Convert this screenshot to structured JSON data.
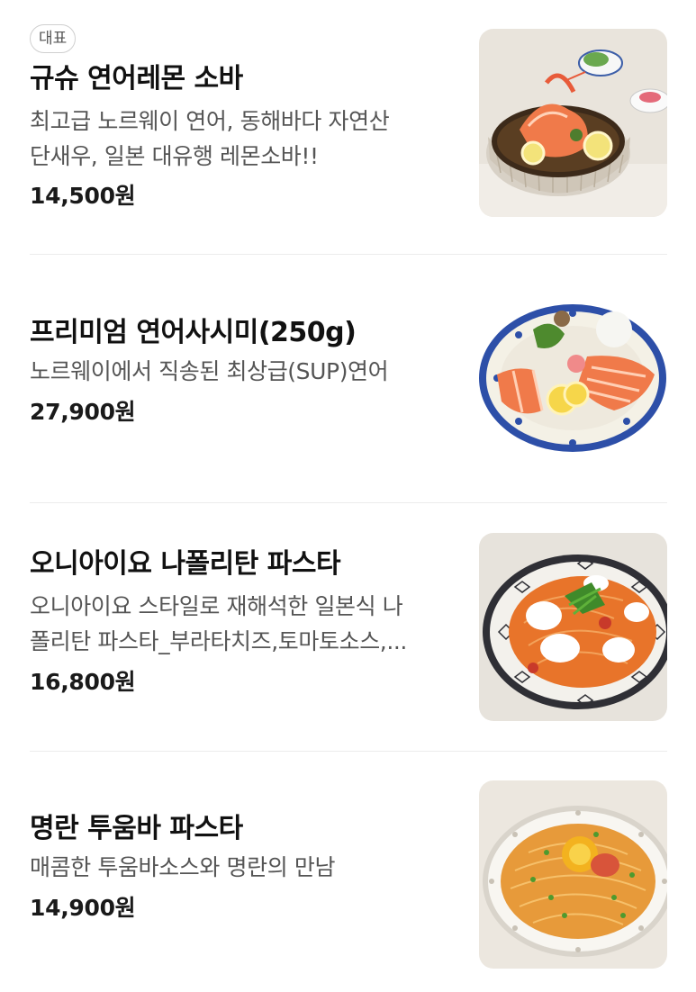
{
  "menu": {
    "items": [
      {
        "badge": "대표",
        "name": "규슈 연어레몬 소바",
        "desc_lines": [
          "최고급 노르웨이 연어, 동해바다 자연산",
          "단새우, 일본 대유행 레몬소바!!"
        ],
        "price": "14,500원",
        "image_icon": "salmon-lemon-soba-photo"
      },
      {
        "name": "프리미엄 연어사시미(250g)",
        "desc_lines": [
          "노르웨이에서 직송된 최상급(SUP)연어"
        ],
        "price": "27,900원",
        "image_icon": "salmon-sashimi-photo"
      },
      {
        "name": "오니아이요 나폴리탄 파스타",
        "desc_lines": [
          "오니아이요 스타일로 재해석한 일본식 나",
          "폴리탄 파스타_부라타치즈,토마토소스,..."
        ],
        "price": "16,800원",
        "image_icon": "napolitan-pasta-photo"
      },
      {
        "name": "명란 투움바 파스타",
        "desc_lines": [
          "매콤한 투움바소스와 명란의 만남"
        ],
        "price": "14,900원",
        "image_icon": "mentaiko-toowoomba-pasta-photo"
      }
    ]
  }
}
